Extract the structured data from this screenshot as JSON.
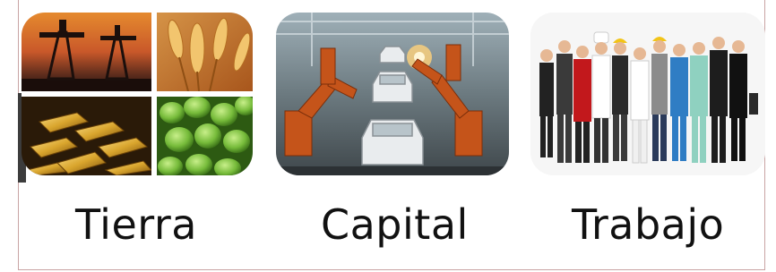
{
  "slide": {
    "labels": [
      "Tierra",
      "Capital",
      "Trabajo"
    ],
    "images": [
      {
        "name": "collage-land-resources",
        "description_icons": [
          "oil-pumps-sunset",
          "wheat",
          "gold-bars",
          "green-olives"
        ]
      },
      {
        "name": "car-factory-robots"
      },
      {
        "name": "workers-professions-group"
      }
    ],
    "colors": {
      "background": "#ffffff",
      "label": "#111111",
      "frame": "#c9a3a3"
    }
  }
}
